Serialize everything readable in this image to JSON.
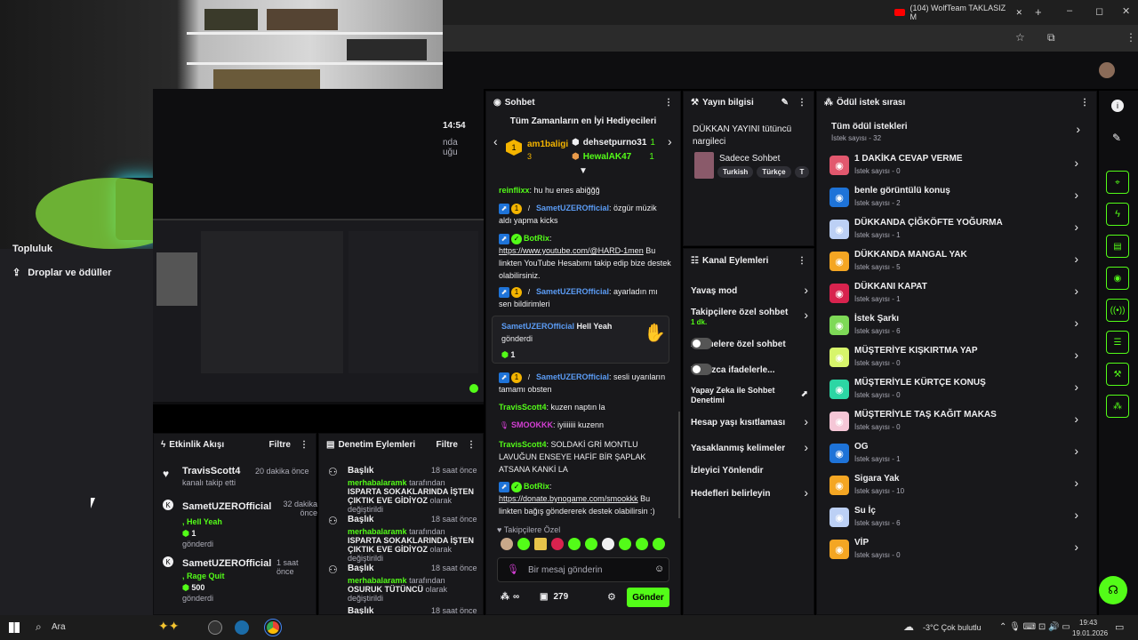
{
  "browser": {
    "tab_title": "(104) WolfTeam TAKLASIZ M",
    "new_tab": "+",
    "minimize": "–",
    "maximize": "◻",
    "close": "✕"
  },
  "left_sidebar": {
    "items": [
      {
        "label": "Topluluk"
      },
      {
        "label": "Droplar ve ödüller"
      }
    ]
  },
  "preview": {
    "time": "14:54",
    "text1": "nda",
    "text2": "uğu"
  },
  "chat": {
    "title": "Sohbet",
    "top_gifters_title": "Tüm Zamanların en İyi Hediyecileri",
    "gifters": [
      {
        "name": "am1baligi",
        "count": "3",
        "rank": "1"
      },
      {
        "name": "dehsetpurno31",
        "count": "1"
      },
      {
        "name": "HewalAK47",
        "count": "1"
      }
    ],
    "messages": [
      {
        "user": "reinflixx",
        "text": "hu hu enes abiğğğ"
      },
      {
        "user": "SametUZEROfficial",
        "text": "özgür müzik aldı yapma kicks"
      },
      {
        "user": "BotRix",
        "text": "",
        "link": "https://www.youtube.com/@HARD-1men",
        "text2": "Bu linkten YouTube Hesabımı takip edip bize destek olabilirsiniz."
      },
      {
        "user": "SametUZEROfficial",
        "text": "ayarladın mı sen bildirimleri"
      },
      {
        "user": "SametUZEROfficial",
        "text": "sesli uyarıların tamamı obsten"
      },
      {
        "user": "TravisScott4",
        "text": "kuzen naptın la"
      },
      {
        "user": "SMOOKKK",
        "text": "iyiiiiiii kuzenn"
      },
      {
        "user": "TravisScott4",
        "text": "SOLDAKİ GRİ MONTLU LAVUĞUN ENSEYE HAFİF BİR ŞAPLAK ATSANA KANKİ LA"
      },
      {
        "user": "BotRix",
        "text": "",
        "link": "https://donate.bynogame.com/smookkk",
        "text2": "Bu linkten bağış göndererek destek olabilirsin :)"
      }
    ],
    "highlight": {
      "user": "SametUZEROfficial",
      "label": "Hell Yeah",
      "text": "gönderdi",
      "count": "1"
    },
    "followers_only": "Takipçilere Özel",
    "input_placeholder": "Bir mesaj gönderin",
    "points": "279",
    "infinity": "∞",
    "send": "Gönder"
  },
  "stream_info": {
    "title": "Yayın bilgisi",
    "stream_title": "DÜKKAN YAYINI tütüncü nargileci",
    "category": "Sadece Sohbet",
    "tags": [
      "Turkish",
      "Türkçe",
      "T"
    ]
  },
  "channel_actions": {
    "title": "Kanal Eylemleri",
    "items": [
      {
        "label": "Yavaş mod",
        "type": "chevron"
      },
      {
        "label": "Takipçilere özel sohbet",
        "sub": "1 dk.",
        "type": "chevron"
      },
      {
        "label": "Abonelere özel sohbet",
        "type": "toggle"
      },
      {
        "label": "Yalnızca ifadelerle...",
        "type": "toggle"
      },
      {
        "label": "Yapay Zeka ile Sohbet Denetimi",
        "type": "ext"
      },
      {
        "label": "Hesap yaşı kısıtlaması",
        "type": "chevron"
      },
      {
        "label": "Yasaklanmış kelimeler",
        "type": "chevron"
      },
      {
        "label": "İzleyici Yönlendir",
        "type": "none"
      },
      {
        "label": "Hedefleri belirleyin",
        "type": "chevron"
      }
    ]
  },
  "rewards": {
    "title": "Ödül istek sırası",
    "all": {
      "label": "Tüm ödül istekleri",
      "sub": "İstek sayısı - 32"
    },
    "items": [
      {
        "label": "1 DAKİKA CEVAP VERME",
        "sub": "İstek sayısı - 0",
        "color": "#e2586e"
      },
      {
        "label": "benle görüntülü konuş",
        "sub": "İstek sayısı - 2",
        "color": "#1e73d8"
      },
      {
        "label": "DÜKKANDA ÇİĞKÖFTE YOĞURMA",
        "sub": "İstek sayısı - 1",
        "color": "#bcd0f5"
      },
      {
        "label": "DÜKKANDA MANGAL YAK",
        "sub": "İstek sayısı - 5",
        "color": "#f4a623"
      },
      {
        "label": "DÜKKANI KAPAT",
        "sub": "İstek sayısı - 1",
        "color": "#d8234e"
      },
      {
        "label": "İstek Şarkı",
        "sub": "İstek sayısı - 6",
        "color": "#7ed957"
      },
      {
        "label": "MÜŞTERİYE KIŞKIRTMA YAP",
        "sub": "İstek sayısı - 0",
        "color": "#d7f56b"
      },
      {
        "label": "MÜŞTERİYLE KÜRTÇE KONUŞ",
        "sub": "İstek sayısı - 0",
        "color": "#2cd6a4"
      },
      {
        "label": "MÜŞTERİYLE TAŞ KAĞIT MAKAS",
        "sub": "İstek sayısı - 0",
        "color": "#f5c6d6"
      },
      {
        "label": "OG",
        "sub": "İstek sayısı - 1",
        "color": "#1e73d8"
      },
      {
        "label": "Sigara Yak",
        "sub": "İstek sayısı - 10",
        "color": "#f4a623"
      },
      {
        "label": "Su İç",
        "sub": "İstek sayısı - 6",
        "color": "#bcd0f5"
      },
      {
        "label": "VİP",
        "sub": "İstek sayısı - 0",
        "color": "#f4a623"
      }
    ]
  },
  "activity": {
    "title": "Etkinlik Akışı",
    "filter": "Filtre",
    "items": [
      {
        "user": "TravisScott4",
        "text": "kanalı takip etti",
        "time": "20 dakika önce"
      },
      {
        "user": "SametUZEROfficial",
        "reward": ", Hell Yeah",
        "count": "1",
        "text": "gönderdi",
        "time": "32 dakika önce"
      },
      {
        "user": "SametUZEROfficial",
        "reward": ", Rage Quit",
        "count": "500",
        "text": "gönderdi",
        "time": "1 saat önce"
      }
    ]
  },
  "mod_actions": {
    "title": "Denetim Eylemleri",
    "filter": "Filtre",
    "items": [
      {
        "heading": "Başlık",
        "time": "18 saat önce",
        "user": "merhabalaramk",
        "mid": "tarafından",
        "value": "ISPARTA SOKAKLARINDA İŞTEN ÇIKTIK EVE GİDİYOZ",
        "end": "olarak değiştirildi"
      },
      {
        "heading": "Başlık",
        "time": "18 saat önce",
        "user": "merhabalaramk",
        "mid": "tarafından",
        "value": "ISPARTA SOKAKLARINDA İŞTEN ÇIKTIK EVE GİDİYOZ",
        "end": "olarak değiştirildi"
      },
      {
        "heading": "Başlık",
        "time": "18 saat önce",
        "user": "merhabalaramk",
        "mid": "tarafından",
        "value": "OSURUK TÜTÜNCÜ",
        "end": "olarak değiştirildi"
      },
      {
        "heading": "Başlık",
        "time": "18 saat önce"
      }
    ]
  },
  "taskbar": {
    "search": "Ara",
    "weather": "-3°C  Çok bulutlu",
    "time": "19:43",
    "date": "19.01.2026"
  },
  "colors": {
    "accent": "#53fc18",
    "panel": "#18181b",
    "bg": "#0e0e10",
    "user_green": "#53fc18",
    "user_blue": "#5b9cf5"
  }
}
